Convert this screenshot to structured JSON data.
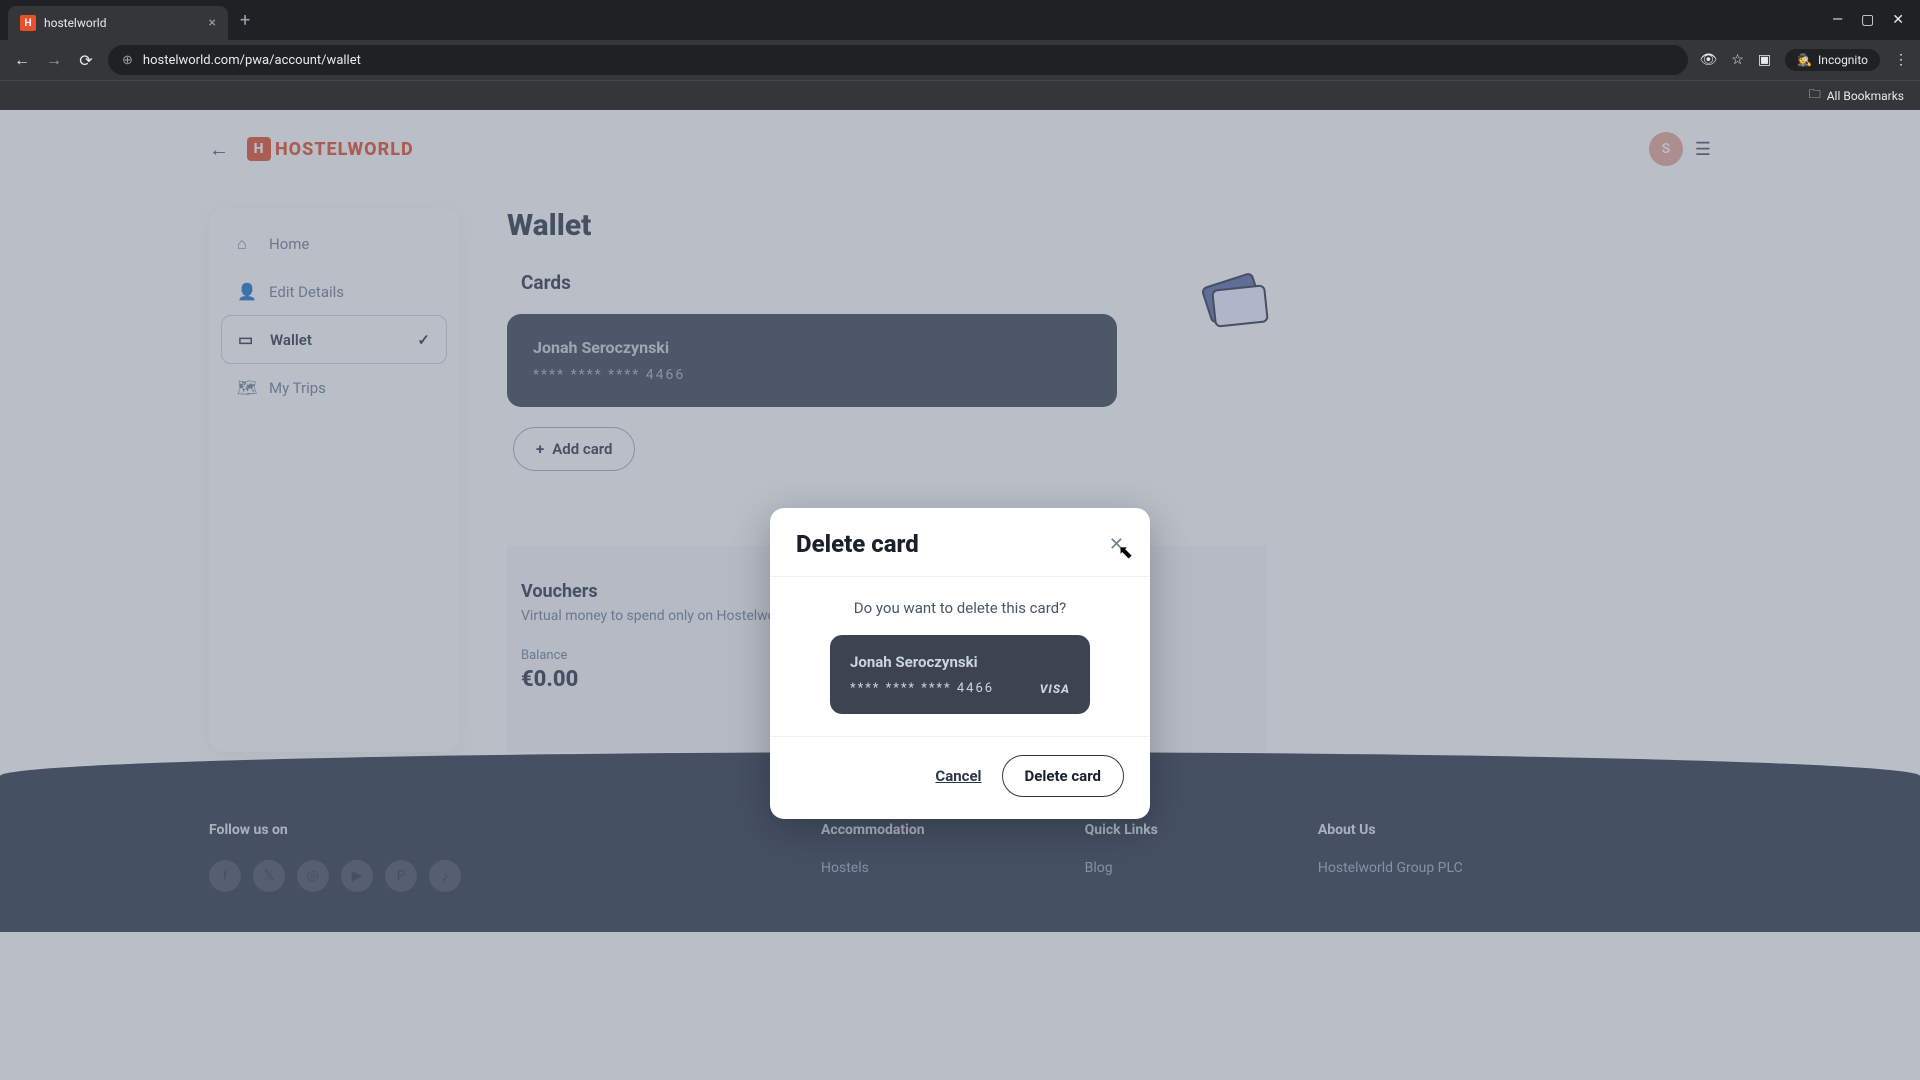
{
  "browser": {
    "tab_title": "hostelworld",
    "url": "hostelworld.com/pwa/account/wallet",
    "incognito_label": "Incognito",
    "all_bookmarks": "All Bookmarks"
  },
  "header": {
    "logo_text": "HOSTELWORLD",
    "avatar_initial": "S"
  },
  "sidebar": {
    "items": [
      {
        "label": "Home"
      },
      {
        "label": "Edit Details"
      },
      {
        "label": "Wallet"
      },
      {
        "label": "My Trips"
      }
    ]
  },
  "main": {
    "page_title": "Wallet",
    "cards_title": "Cards",
    "card": {
      "holder": "Jonah Seroczynski",
      "number_mask": "**** **** **** 4466"
    },
    "add_card_label": "Add card",
    "vouchers": {
      "title": "Vouchers",
      "subtitle": "Virtual money to spend only on Hostelworld",
      "balance_label": "Balance",
      "balance_value": "€0.00"
    }
  },
  "modal": {
    "title": "Delete card",
    "message": "Do you want to delete this card?",
    "card": {
      "holder": "Jonah Seroczynski",
      "number_mask": "**** **** **** 4466",
      "brand": "VISA"
    },
    "cancel_label": "Cancel",
    "delete_label": "Delete card"
  },
  "footer": {
    "follow": "Follow us on",
    "col1_head": "Accommodation",
    "col1_link": "Hostels",
    "col2_head": "Quick Links",
    "col2_link": "Blog",
    "col3_head": "About Us",
    "col3_link": "Hostelworld Group PLC"
  }
}
